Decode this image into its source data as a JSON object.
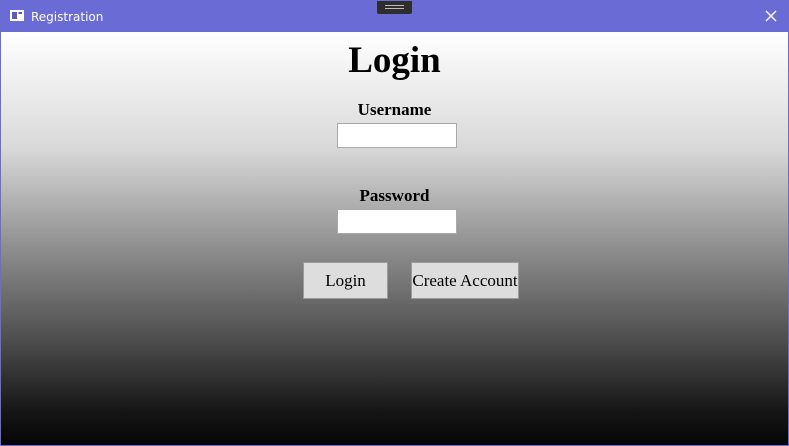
{
  "window": {
    "title": "Registration",
    "titlebar_color": "#6b6bd6",
    "app_icon": "window-icon",
    "close_icon": "close-icon"
  },
  "form": {
    "heading": "Login",
    "username": {
      "label": "Username",
      "value": ""
    },
    "password": {
      "label": "Password",
      "value": ""
    },
    "buttons": {
      "login": "Login",
      "create_account": "Create Account"
    }
  }
}
